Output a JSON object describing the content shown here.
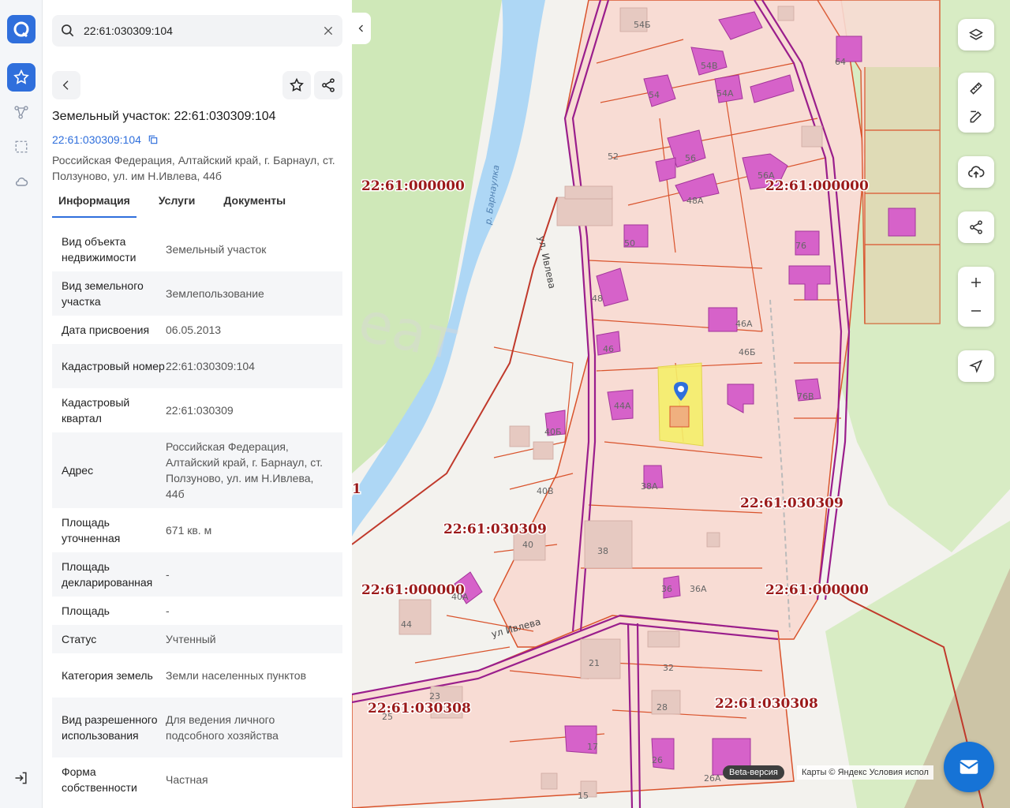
{
  "search": {
    "value": "22:61:030309:104"
  },
  "object": {
    "title": "Земельный участок: 22:61:030309:104",
    "number_link": "22:61:030309:104",
    "address": "Российская Федерация, Алтайский край, г. Барнаул, ст. Ползуново, ул. им Н.Ивлева, 44б"
  },
  "tabs": [
    {
      "label": "Информация"
    },
    {
      "label": "Услуги"
    },
    {
      "label": "Документы"
    }
  ],
  "info_rows": [
    {
      "key": "Вид объекта недвижимости",
      "value": "Земельный участок"
    },
    {
      "key": "Вид земельного участка",
      "value": "Землепользование"
    },
    {
      "key": "Дата присвоения",
      "value": "06.05.2013"
    },
    {
      "key": "Кадастровый номер",
      "value": "22:61:030309:104"
    },
    {
      "key": "Кадастровый квартал",
      "value": "22:61:030309"
    },
    {
      "key": "Адрес",
      "value": "Российская Федерация, Алтайский край, г. Барнаул, ст. Ползуново, ул. им Н.Ивлева, 44б"
    },
    {
      "key": "Площадь уточненная",
      "value": "671 кв. м"
    },
    {
      "key": "Площадь декларированная",
      "value": "-"
    },
    {
      "key": "Площадь",
      "value": "-"
    },
    {
      "key": "Статус",
      "value": "Учтенный"
    },
    {
      "key": "Категория земель",
      "value": "Земли населенных пунктов"
    },
    {
      "key": "Вид разрешенного использования",
      "value": "Для ведения личного подсобного хозяйства"
    },
    {
      "key": "Форма собственности",
      "value": "Частная"
    }
  ],
  "map": {
    "river": "р. Барнаулка",
    "streets": [
      "ул. Ивлева",
      "ул Ивлева"
    ],
    "quarters": [
      "22:61:000000",
      "22:61:000000",
      "22:61:030309",
      "22:61:030309",
      "22:61:000000",
      "22:61:000000",
      "22:61:030308",
      "22:61:030308"
    ],
    "edge_label": "1",
    "house_numbers": [
      "54Б",
      "54В",
      "64",
      "54",
      "54А",
      "52",
      "56",
      "56А",
      "48А",
      "50",
      "76",
      "48",
      "46А",
      "46",
      "46Б",
      "44А",
      "76В",
      "40Б",
      "38А",
      "40В",
      "40",
      "38",
      "36",
      "36А",
      "40А",
      "44",
      "21",
      "32",
      "23",
      "25",
      "28",
      "17",
      "26",
      "26А",
      "15"
    ],
    "watermark": "еат",
    "beta": "Beta-версия",
    "attribution": "Карты © Яндекс   Условия испол"
  },
  "colors": {
    "accent": "#2f6fdc",
    "parcel_fill": "#f8dcd4",
    "parcel_border": "#d9532c",
    "building": "#d662c9",
    "selected": "#f5ef6a",
    "river": "#aed7f5"
  }
}
